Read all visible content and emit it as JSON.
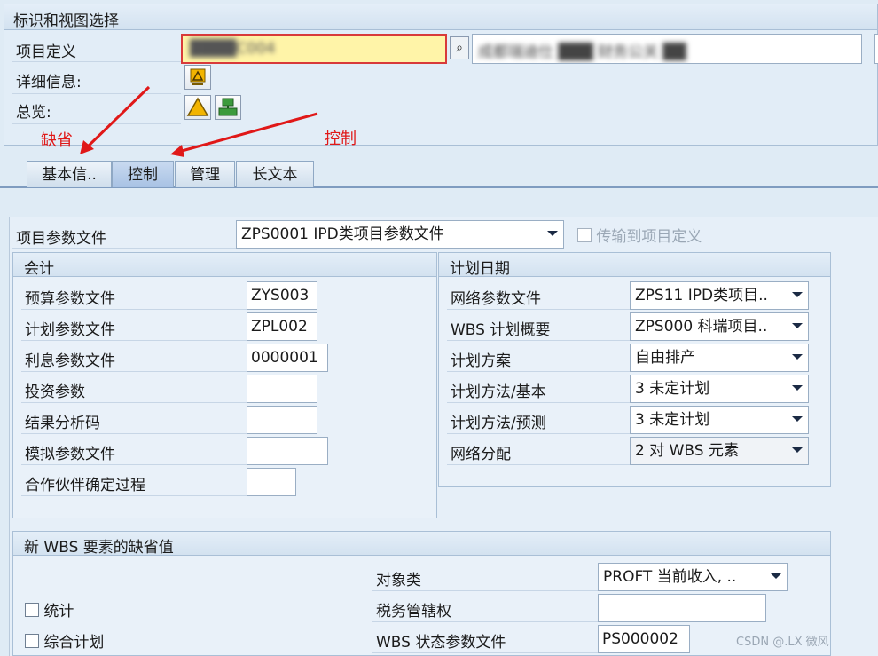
{
  "header": {
    "title": "标识和视图选择",
    "project_label": "项目定义",
    "project_value": "████C004",
    "project_desc": "成都瑞迪仕 ███ 财务公关 ██",
    "detail_label": "详细信息:",
    "overview_label": "总览:"
  },
  "annotations": {
    "default_label": "缺省",
    "control_label": "控制"
  },
  "tabs": [
    "基本信..",
    "控制",
    "管理",
    "长文本"
  ],
  "project_profile": {
    "label": "项目参数文件",
    "value": "ZPS0001 IPD类项目参数文件",
    "transfer_label": "传输到项目定义"
  },
  "accounting": {
    "title": "会计",
    "fields": [
      {
        "label": "预算参数文件",
        "value": "ZYS003"
      },
      {
        "label": "计划参数文件",
        "value": "ZPL002"
      },
      {
        "label": "利息参数文件",
        "value": "0000001"
      },
      {
        "label": "投资参数",
        "value": ""
      },
      {
        "label": "结果分析码",
        "value": ""
      },
      {
        "label": "模拟参数文件",
        "value": ""
      },
      {
        "label": "合作伙伴确定过程",
        "value": ""
      }
    ]
  },
  "plan_dates": {
    "title": "计划日期",
    "fields": [
      {
        "label": "网络参数文件",
        "value": "ZPS11 IPD类项目.."
      },
      {
        "label": "WBS 计划概要",
        "value": "ZPS000 科瑞项目.."
      },
      {
        "label": "计划方案",
        "value": "自由排产"
      },
      {
        "label": "计划方法/基本",
        "value": "3 未定计划"
      },
      {
        "label": "计划方法/预测",
        "value": "3 未定计划"
      },
      {
        "label": "网络分配",
        "value": "2 对 WBS 元素"
      }
    ]
  },
  "wbs_defaults": {
    "title": "新 WBS 要素的缺省值",
    "object_class_label": "对象类",
    "object_class_value": "PROFT 当前收入, ..",
    "statistics_label": "统计",
    "tax_label": "税务管辖权",
    "tax_value": "",
    "integrated_label": "综合计划",
    "status_label": "WBS 状态参数文件",
    "status_value": "PS000002"
  },
  "watermark": "CSDN @.LX 微风",
  "colors": {
    "background": "#dfebf5",
    "input_highlight": "#fff4a8",
    "annotation": "#e01818",
    "warning_icon": "#f2b400",
    "network_icon": "#3c9a3c"
  },
  "icons": [
    "search-help-icon",
    "warning-icon",
    "network-icon"
  ]
}
